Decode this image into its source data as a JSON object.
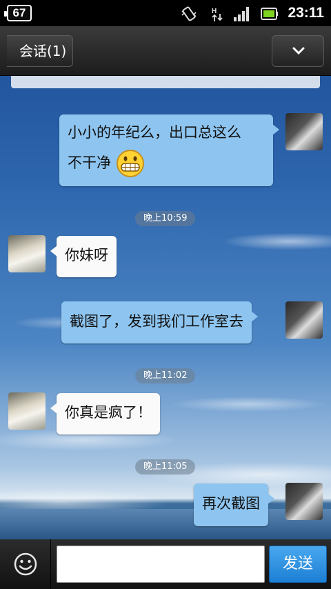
{
  "status_bar": {
    "battery_level": "67",
    "time": "23:11",
    "icons": [
      "vibrate-icon",
      "data-arrows-icon",
      "signal-icon",
      "battery-icon"
    ]
  },
  "header": {
    "back_label": "会话(1)",
    "menu_icon": "chevron-down-icon"
  },
  "messages": [
    {
      "type": "text",
      "side": "right",
      "text": "小小的年纪么，出口总这么",
      "text2": "不干净",
      "emoji": "grin-emoji"
    },
    {
      "type": "time",
      "text": "晚上10:59"
    },
    {
      "type": "text",
      "side": "left",
      "text": "你妹呀"
    },
    {
      "type": "text",
      "side": "right",
      "text": "截图了，发到我们工作室去"
    },
    {
      "type": "time",
      "text": "晚上11:02"
    },
    {
      "type": "text",
      "side": "left",
      "text": "你真是疯了！"
    },
    {
      "type": "time",
      "text": "晚上11:05"
    },
    {
      "type": "text",
      "side": "right",
      "text": "再次截图"
    }
  ],
  "input_bar": {
    "emoji_icon": "smiley-icon",
    "input_value": "",
    "send_label": "发送"
  },
  "colors": {
    "bubble_right": "#8ec5f0",
    "bubble_left": "#fafafa",
    "send_button": "#2a8fe0"
  }
}
